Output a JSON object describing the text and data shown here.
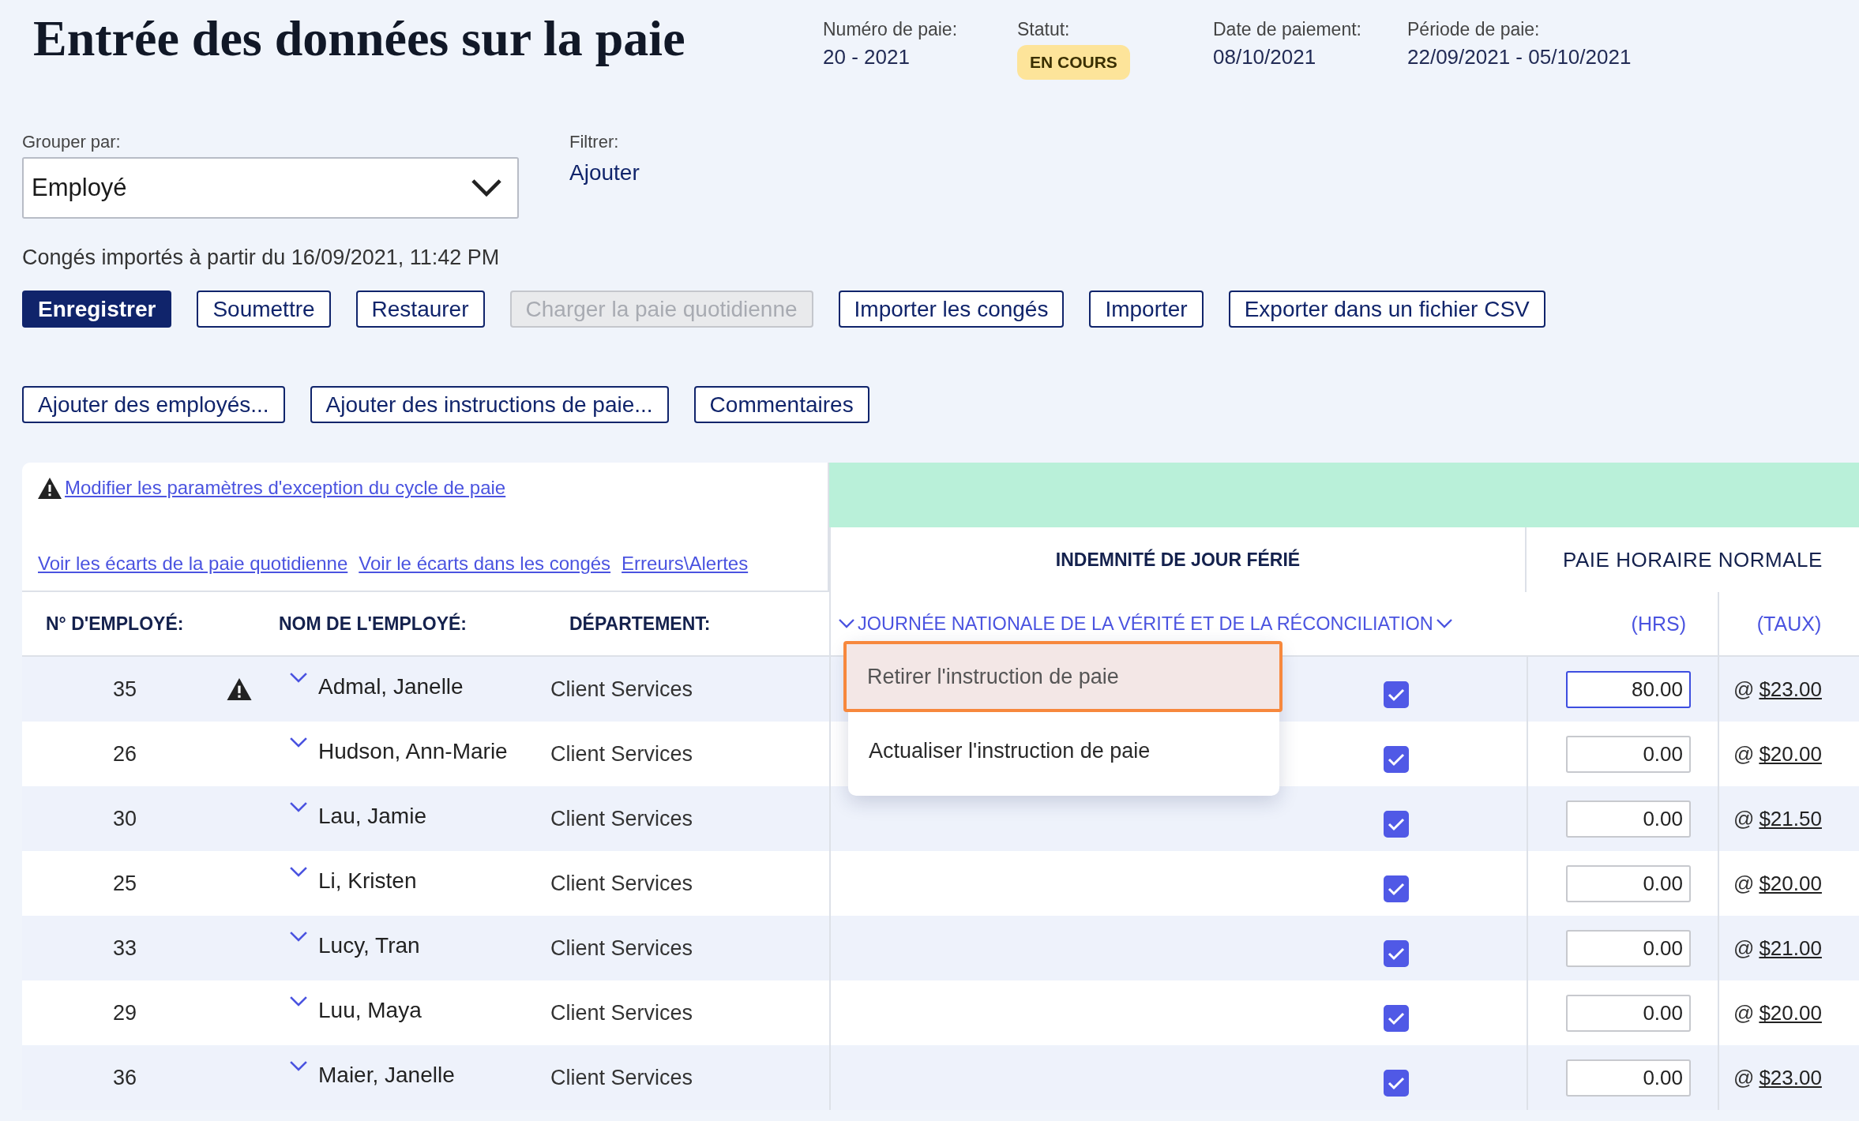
{
  "title": "Entrée des données sur la paie",
  "summary": [
    {
      "label": "Numéro de paie:",
      "value": "20 - 2021",
      "kind": "text"
    },
    {
      "label": "Statut:",
      "value": "EN COURS",
      "kind": "badge"
    },
    {
      "label": "Date de paiement:",
      "value": "08/10/2021",
      "kind": "text"
    },
    {
      "label": "Période de paie:",
      "value": "22/09/2021 - 05/10/2021",
      "kind": "text"
    }
  ],
  "group_by": {
    "label": "Grouper par:",
    "value": "Employé"
  },
  "filter": {
    "label": "Filtrer:",
    "link": "Ajouter"
  },
  "import_note": "Congés importés à partir du 16/09/2021, 11:42 PM",
  "toolbar": [
    {
      "label": "Enregistrer",
      "primary": true,
      "disabled": false
    },
    {
      "label": "Soumettre",
      "primary": false,
      "disabled": false
    },
    {
      "label": "Restaurer",
      "primary": false,
      "disabled": false
    },
    {
      "label": "Charger la paie quotidienne",
      "primary": false,
      "disabled": true
    },
    {
      "label": "Importer les congés",
      "primary": false,
      "disabled": false
    },
    {
      "label": "Importer",
      "primary": false,
      "disabled": false
    },
    {
      "label": "Exporter dans un fichier CSV",
      "primary": false,
      "disabled": false
    }
  ],
  "toolbar_2": [
    {
      "label": "Ajouter des employés...",
      "primary": false,
      "disabled": false
    },
    {
      "label": "Ajouter des instructions de paie...",
      "primary": false,
      "disabled": false
    },
    {
      "label": "Commentaires",
      "primary": false,
      "disabled": false
    }
  ],
  "exception_link": "Modifier les paramètres d'exception du cycle de paie",
  "links": [
    "Voir les écarts de la paie quotidienne",
    "Voir le écarts dans les congés",
    "Erreurs\\Alertes"
  ],
  "table": {
    "columns": [
      "N° D'EMPLOYÉ:",
      "NOM DE L'EMPLOYÉ:",
      "DÉPARTEMENT:"
    ],
    "holiday_header": "INDEMNITÉ DE JOUR FÉRIÉ",
    "holiday_sub": "JOURNÉE NATIONALE DE LA VÉRITÉ ET DE LA RÉCONCILIATION",
    "normal_header": "PAIE HORAIRE NORMALE",
    "hours_header": "(HRS)",
    "rate_header": "(TAUX)",
    "rows": [
      {
        "id": "35",
        "warning": true,
        "name": "Admal, Janelle",
        "department": "Client Services",
        "holiday": true,
        "hours": "80.00",
        "focused": true,
        "rate_prefix": "@",
        "rate": "$23.00"
      },
      {
        "id": "26",
        "warning": false,
        "name": "Hudson, Ann-Marie",
        "department": "Client Services",
        "holiday": true,
        "hours": "0.00",
        "focused": false,
        "rate_prefix": "@",
        "rate": "$20.00"
      },
      {
        "id": "30",
        "warning": false,
        "name": "Lau, Jamie",
        "department": "Client Services",
        "holiday": true,
        "hours": "0.00",
        "focused": false,
        "rate_prefix": "@",
        "rate": "$21.50"
      },
      {
        "id": "25",
        "warning": false,
        "name": "Li, Kristen",
        "department": "Client Services",
        "holiday": true,
        "hours": "0.00",
        "focused": false,
        "rate_prefix": "@",
        "rate": "$20.00"
      },
      {
        "id": "33",
        "warning": false,
        "name": "Lucy, Tran",
        "department": "Client Services",
        "holiday": true,
        "hours": "0.00",
        "focused": false,
        "rate_prefix": "@",
        "rate": "$21.00"
      },
      {
        "id": "29",
        "warning": false,
        "name": "Luu, Maya",
        "department": "Client Services",
        "holiday": true,
        "hours": "0.00",
        "focused": false,
        "rate_prefix": "@",
        "rate": "$20.00"
      },
      {
        "id": "36",
        "warning": false,
        "name": "Maier, Janelle",
        "department": "Client Services",
        "holiday": true,
        "hours": "0.00",
        "focused": false,
        "rate_prefix": "@",
        "rate": "$23.00"
      }
    ]
  },
  "context_menu": {
    "items": [
      {
        "label": "Retirer l'instruction de paie",
        "selected": true
      },
      {
        "label": "Actualiser l'instruction de paie",
        "selected": false
      }
    ]
  }
}
